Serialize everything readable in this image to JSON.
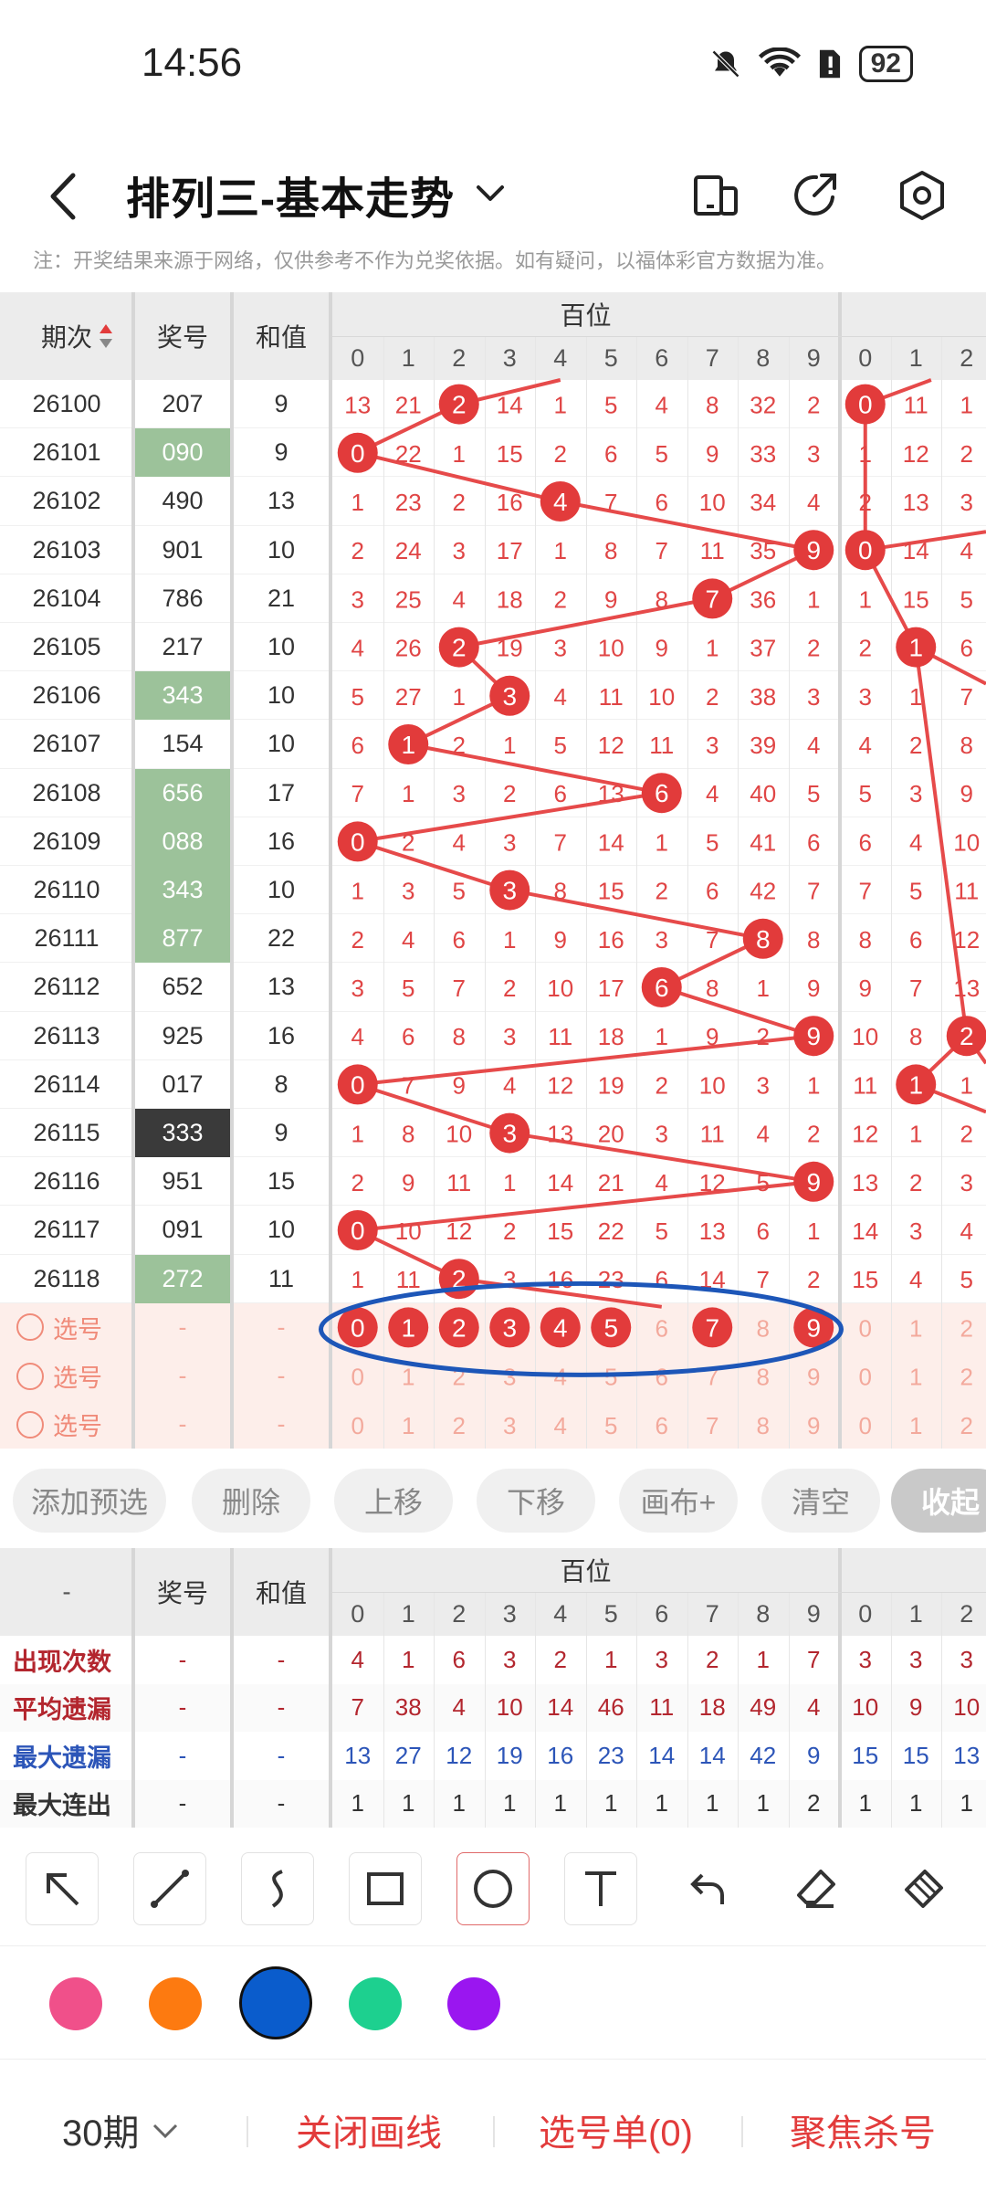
{
  "status_bar": {
    "time": "14:56",
    "battery": "92"
  },
  "header": {
    "title": "排列三-基本走势",
    "icons": [
      "back-icon",
      "chevron-down-icon",
      "layout-icon",
      "share-icon",
      "settings-icon"
    ]
  },
  "notice": "注：开奖结果来源于网络，仅供参考不作为兑奖依据。如有疑问，以福体彩官方数据为准。",
  "table": {
    "col_issue": "期次",
    "col_number": "奖号",
    "col_sum": "和值",
    "group_hundreds": "百位",
    "digits": [
      "0",
      "1",
      "2",
      "3",
      "4",
      "5",
      "6",
      "7",
      "8",
      "9"
    ],
    "tens_digits": [
      "0",
      "1",
      "2"
    ],
    "rows": [
      {
        "issue": "26100",
        "number": "207",
        "sum": "9",
        "h": [
          "13",
          "21",
          "2",
          "14",
          "1",
          "5",
          "4",
          "8",
          "32",
          "2"
        ],
        "hit": 2,
        "t": [
          "0",
          "11",
          "1"
        ],
        "thit": 0,
        "nb": "plain"
      },
      {
        "issue": "26101",
        "number": "090",
        "sum": "9",
        "h": [
          "0",
          "22",
          "1",
          "15",
          "2",
          "6",
          "5",
          "9",
          "33",
          "3"
        ],
        "hit": 0,
        "t": [
          "1",
          "12",
          "2"
        ],
        "thit": -1,
        "nb": "green"
      },
      {
        "issue": "26102",
        "number": "490",
        "sum": "13",
        "h": [
          "1",
          "23",
          "2",
          "16",
          "4",
          "7",
          "6",
          "10",
          "34",
          "4"
        ],
        "hit": 4,
        "t": [
          "2",
          "13",
          "3"
        ],
        "thit": -1,
        "nb": "plain"
      },
      {
        "issue": "26103",
        "number": "901",
        "sum": "10",
        "h": [
          "2",
          "24",
          "3",
          "17",
          "1",
          "8",
          "7",
          "11",
          "35",
          "9"
        ],
        "hit": 9,
        "t": [
          "0",
          "14",
          "4"
        ],
        "thit": 0,
        "nb": "plain"
      },
      {
        "issue": "26104",
        "number": "786",
        "sum": "21",
        "h": [
          "3",
          "25",
          "4",
          "18",
          "2",
          "9",
          "8",
          "7",
          "36",
          "1"
        ],
        "hit": 7,
        "t": [
          "1",
          "15",
          "5"
        ],
        "thit": -1,
        "nb": "plain"
      },
      {
        "issue": "26105",
        "number": "217",
        "sum": "10",
        "h": [
          "4",
          "26",
          "2",
          "19",
          "3",
          "10",
          "9",
          "1",
          "37",
          "2"
        ],
        "hit": 2,
        "t": [
          "2",
          "1",
          "6"
        ],
        "thit": 1,
        "nb": "plain"
      },
      {
        "issue": "26106",
        "number": "343",
        "sum": "10",
        "h": [
          "5",
          "27",
          "1",
          "3",
          "4",
          "11",
          "10",
          "2",
          "38",
          "3"
        ],
        "hit": 3,
        "t": [
          "3",
          "1",
          "7"
        ],
        "thit": -1,
        "nb": "green"
      },
      {
        "issue": "26107",
        "number": "154",
        "sum": "10",
        "h": [
          "6",
          "1",
          "2",
          "1",
          "5",
          "12",
          "11",
          "3",
          "39",
          "4"
        ],
        "hit": 1,
        "t": [
          "4",
          "2",
          "8"
        ],
        "thit": -1,
        "nb": "plain"
      },
      {
        "issue": "26108",
        "number": "656",
        "sum": "17",
        "h": [
          "7",
          "1",
          "3",
          "2",
          "6",
          "13",
          "6",
          "4",
          "40",
          "5"
        ],
        "hit": 6,
        "t": [
          "5",
          "3",
          "9"
        ],
        "thit": -1,
        "nb": "green"
      },
      {
        "issue": "26109",
        "number": "088",
        "sum": "16",
        "h": [
          "0",
          "2",
          "4",
          "3",
          "7",
          "14",
          "1",
          "5",
          "41",
          "6"
        ],
        "hit": 0,
        "t": [
          "6",
          "4",
          "10"
        ],
        "thit": -1,
        "nb": "green"
      },
      {
        "issue": "26110",
        "number": "343",
        "sum": "10",
        "h": [
          "1",
          "3",
          "5",
          "3",
          "8",
          "15",
          "2",
          "6",
          "42",
          "7"
        ],
        "hit": 3,
        "t": [
          "7",
          "5",
          "11"
        ],
        "thit": -1,
        "nb": "green"
      },
      {
        "issue": "26111",
        "number": "877",
        "sum": "22",
        "h": [
          "2",
          "4",
          "6",
          "1",
          "9",
          "16",
          "3",
          "7",
          "8",
          "8"
        ],
        "hit": 8,
        "t": [
          "8",
          "6",
          "12"
        ],
        "thit": -1,
        "nb": "green"
      },
      {
        "issue": "26112",
        "number": "652",
        "sum": "13",
        "h": [
          "3",
          "5",
          "7",
          "2",
          "10",
          "17",
          "6",
          "8",
          "1",
          "9"
        ],
        "hit": 6,
        "t": [
          "9",
          "7",
          "13"
        ],
        "thit": -1,
        "nb": "plain"
      },
      {
        "issue": "26113",
        "number": "925",
        "sum": "16",
        "h": [
          "4",
          "6",
          "8",
          "3",
          "11",
          "18",
          "1",
          "9",
          "2",
          "9"
        ],
        "hit": 9,
        "t": [
          "10",
          "8",
          "2"
        ],
        "thit": 2,
        "nb": "plain"
      },
      {
        "issue": "26114",
        "number": "017",
        "sum": "8",
        "h": [
          "0",
          "7",
          "9",
          "4",
          "12",
          "19",
          "2",
          "10",
          "3",
          "1"
        ],
        "hit": 0,
        "t": [
          "11",
          "1",
          "1"
        ],
        "thit": 1,
        "nb": "plain"
      },
      {
        "issue": "26115",
        "number": "333",
        "sum": "9",
        "h": [
          "1",
          "8",
          "10",
          "3",
          "13",
          "20",
          "3",
          "11",
          "4",
          "2"
        ],
        "hit": 3,
        "t": [
          "12",
          "1",
          "2"
        ],
        "thit": -1,
        "nb": "dark"
      },
      {
        "issue": "26116",
        "number": "951",
        "sum": "15",
        "h": [
          "2",
          "9",
          "11",
          "1",
          "14",
          "21",
          "4",
          "12",
          "5",
          "9"
        ],
        "hit": 9,
        "t": [
          "13",
          "2",
          "3"
        ],
        "thit": -1,
        "nb": "plain"
      },
      {
        "issue": "26117",
        "number": "091",
        "sum": "10",
        "h": [
          "0",
          "10",
          "12",
          "2",
          "15",
          "22",
          "5",
          "13",
          "6",
          "1"
        ],
        "hit": 0,
        "t": [
          "14",
          "3",
          "4"
        ],
        "thit": -1,
        "nb": "plain"
      },
      {
        "issue": "26118",
        "number": "272",
        "sum": "11",
        "h": [
          "1",
          "11",
          "2",
          "3",
          "16",
          "23",
          "6",
          "14",
          "7",
          "2"
        ],
        "hit": 2,
        "t": [
          "15",
          "4",
          "5"
        ],
        "thit": -1,
        "nb": "green"
      }
    ],
    "select_rows": [
      {
        "label": "选号",
        "number": "-",
        "sum": "-",
        "filled": [
          0,
          1,
          2,
          3,
          4,
          5,
          7,
          9
        ]
      },
      {
        "label": "选号",
        "number": "-",
        "sum": "-",
        "filled": []
      },
      {
        "label": "选号",
        "number": "-",
        "sum": "-",
        "filled": []
      }
    ]
  },
  "buttons": [
    "添加预选",
    "删除",
    "上移",
    "下移",
    "画布+",
    "清空",
    "收起"
  ],
  "stats": {
    "dash": "-",
    "col_number": "奖号",
    "col_sum": "和值",
    "group_hundreds": "百位",
    "rows": [
      {
        "label": "出现次数",
        "color": "#b3262e",
        "vals": [
          "4",
          "1",
          "6",
          "3",
          "2",
          "1",
          "3",
          "2",
          "1",
          "7",
          "3",
          "3",
          "3"
        ]
      },
      {
        "label": "平均遗漏",
        "color": "#b3262e",
        "vals": [
          "7",
          "38",
          "4",
          "10",
          "14",
          "46",
          "11",
          "18",
          "49",
          "4",
          "10",
          "9",
          "10"
        ]
      },
      {
        "label": "最大遗漏",
        "color": "#2c55b8",
        "vals": [
          "13",
          "27",
          "12",
          "19",
          "16",
          "23",
          "14",
          "14",
          "42",
          "9",
          "15",
          "15",
          "13"
        ]
      },
      {
        "label": "最大连出",
        "color": "#333333",
        "vals": [
          "1",
          "1",
          "1",
          "1",
          "1",
          "1",
          "1",
          "1",
          "1",
          "2",
          "1",
          "1",
          "1"
        ]
      }
    ]
  },
  "tools": [
    "arrow-tool-icon",
    "line-tool-icon",
    "curve-tool-icon",
    "rectangle-tool-icon",
    "circle-tool-icon",
    "text-tool-icon",
    "undo-icon",
    "eraser-icon",
    "clear-brush-icon"
  ],
  "palette": [
    "#f0508a",
    "#fd7a10",
    "#0a5ccc",
    "#1dd08f",
    "#9a16f0"
  ],
  "bottom_bar": {
    "period": "30期",
    "close_lines": "关闭画线",
    "picks": "选号单(0)",
    "focus": "聚焦杀号"
  }
}
